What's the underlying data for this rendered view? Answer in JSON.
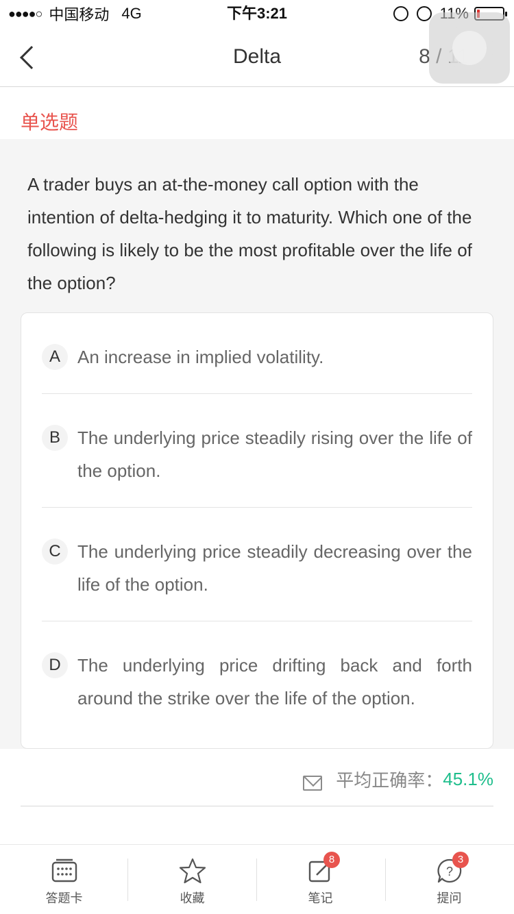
{
  "status_bar": {
    "signal": "●●●●○",
    "carrier": "中国移动",
    "network": "4G",
    "time": "下午3:21",
    "battery": "11%",
    "battery_level": 0.11,
    "battery_color": "#e0302c"
  },
  "nav": {
    "title": "Delta",
    "pager": "8 / 11"
  },
  "question_type": "单选题",
  "question": "A trader buys an at-the-money call option with the intention of delta-hedging it to maturity. Which one of the following is likely to be the most profitable over the life of the option?",
  "options": [
    {
      "letter": "A",
      "text": "An increase in implied volatility."
    },
    {
      "letter": "B",
      "text": "The underlying price steadily rising over the life of the option."
    },
    {
      "letter": "C",
      "text": "The underlying price steadily decreasing over the life of the option."
    },
    {
      "letter": "D",
      "text": "The underlying price drifting back and forth around the strike over the life of the option."
    }
  ],
  "stats": {
    "label": "平均正确率：",
    "value": "45.1%",
    "value_color": "#1fbe8c"
  },
  "tabs": [
    {
      "label": "答题卡",
      "icon": "answer-card-icon"
    },
    {
      "label": "收藏",
      "icon": "star-icon"
    },
    {
      "label": "笔记",
      "icon": "note-edit-icon",
      "badge": "8"
    },
    {
      "label": "提问",
      "icon": "question-bubble-icon",
      "badge": "3"
    }
  ],
  "colors": {
    "accent_red": "#e8544e",
    "accent_green": "#1fbe8c"
  }
}
